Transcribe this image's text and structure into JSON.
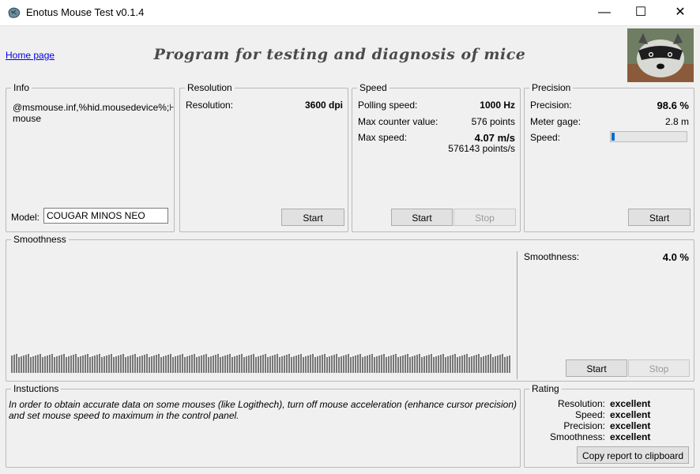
{
  "window": {
    "title": "Enotus Mouse Test v0.1.4",
    "minimize_icon": "—",
    "maximize_icon": "☐",
    "close_icon": "✕"
  },
  "header": {
    "home_link": "Home page",
    "banner": "Program for testing and diagnosis of mice"
  },
  "info": {
    "title": "Info",
    "device_id": "@msmouse.inf,%hid.mousedevice%;⊦\nmouse",
    "model_label": "Model:",
    "model_value": "COUGAR MINOS NEO"
  },
  "resolution": {
    "title": "Resolution",
    "label": "Resolution:",
    "value": "3600 dpi",
    "start": "Start"
  },
  "speed": {
    "title": "Speed",
    "polling_label": "Polling speed:",
    "polling_value": "1000 Hz",
    "counter_label": "Max counter value:",
    "counter_value": "576 points",
    "max_label": "Max  speed:",
    "max_value": "4.07 m/s",
    "max_points": "576143 points/s",
    "start": "Start",
    "stop": "Stop"
  },
  "precision": {
    "title": "Precision",
    "precision_label": "Precision:",
    "precision_value": "98.6 %",
    "meter_label": "Meter gage:",
    "meter_value": "2.8 m",
    "speed_label": "Speed:",
    "speed_fraction": 0.04,
    "start": "Start"
  },
  "smoothness": {
    "title": "Smoothness",
    "label": "Smoothness:",
    "value": "4.0 %",
    "start": "Start",
    "stop": "Stop"
  },
  "instructions": {
    "title": "Instuctions",
    "text": "In order to obtain accurate data on some mouses (like Logithech), turn off mouse acceleration (enhance cursor precision) and set mouse speed to maximum in the control panel."
  },
  "rating": {
    "title": "Rating",
    "rows": [
      {
        "label": "Resolution:",
        "value": "excellent"
      },
      {
        "label": "Speed:",
        "value": "excellent"
      },
      {
        "label": "Precision:",
        "value": "excellent"
      },
      {
        "label": "Smoothness:",
        "value": "excellent"
      }
    ],
    "copy_button": "Copy report to clipboard"
  },
  "colors": {
    "accent": "#0a6ed1",
    "banner": "#4a4a4a"
  }
}
